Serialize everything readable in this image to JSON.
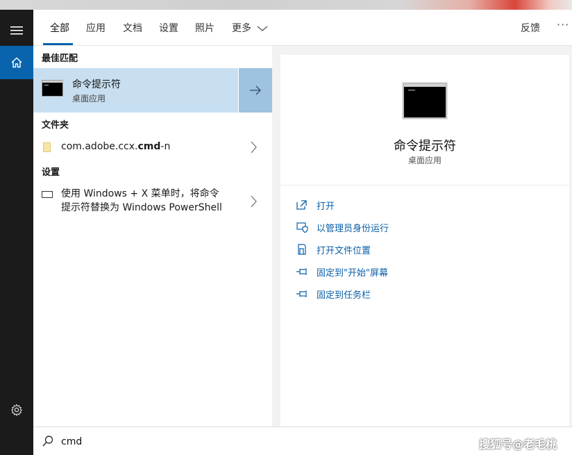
{
  "header": {
    "tabs": [
      {
        "label": "全部",
        "active": true
      },
      {
        "label": "应用"
      },
      {
        "label": "文档"
      },
      {
        "label": "设置"
      },
      {
        "label": "照片"
      },
      {
        "label": "更多"
      }
    ],
    "feedback": "反馈",
    "more_dots": "···"
  },
  "results": {
    "best_match_title": "最佳匹配",
    "best": {
      "title": "命令提示符",
      "subtitle": "桌面应用"
    },
    "folder_title": "文件夹",
    "folder": {
      "pre": "com.adobe.ccx.",
      "bold": "cmd",
      "post": "-n"
    },
    "settings_title": "设置",
    "setting": {
      "line1": "使用 Windows + X 菜单时，将命令",
      "line2": "提示符替换为 Windows PowerShell"
    }
  },
  "detail": {
    "title": "命令提示符",
    "subtitle": "桌面应用",
    "actions": [
      {
        "label": "打开",
        "icon": "open-icon"
      },
      {
        "label": "以管理员身份运行",
        "icon": "shield-run-icon"
      },
      {
        "label": "打开文件位置",
        "icon": "file-location-icon"
      },
      {
        "label": "固定到\"开始\"屏幕",
        "icon": "pin-icon"
      },
      {
        "label": "固定到任务栏",
        "icon": "pin-icon"
      }
    ]
  },
  "search": {
    "value": "cmd"
  },
  "watermark": "搜狐号@老毛桃",
  "colors": {
    "accent": "#0a64ad",
    "selected": "#c8dff1",
    "selected_arrow": "#9fc2e0",
    "link": "#0a5fa8",
    "rail": "#1b1b1b"
  }
}
